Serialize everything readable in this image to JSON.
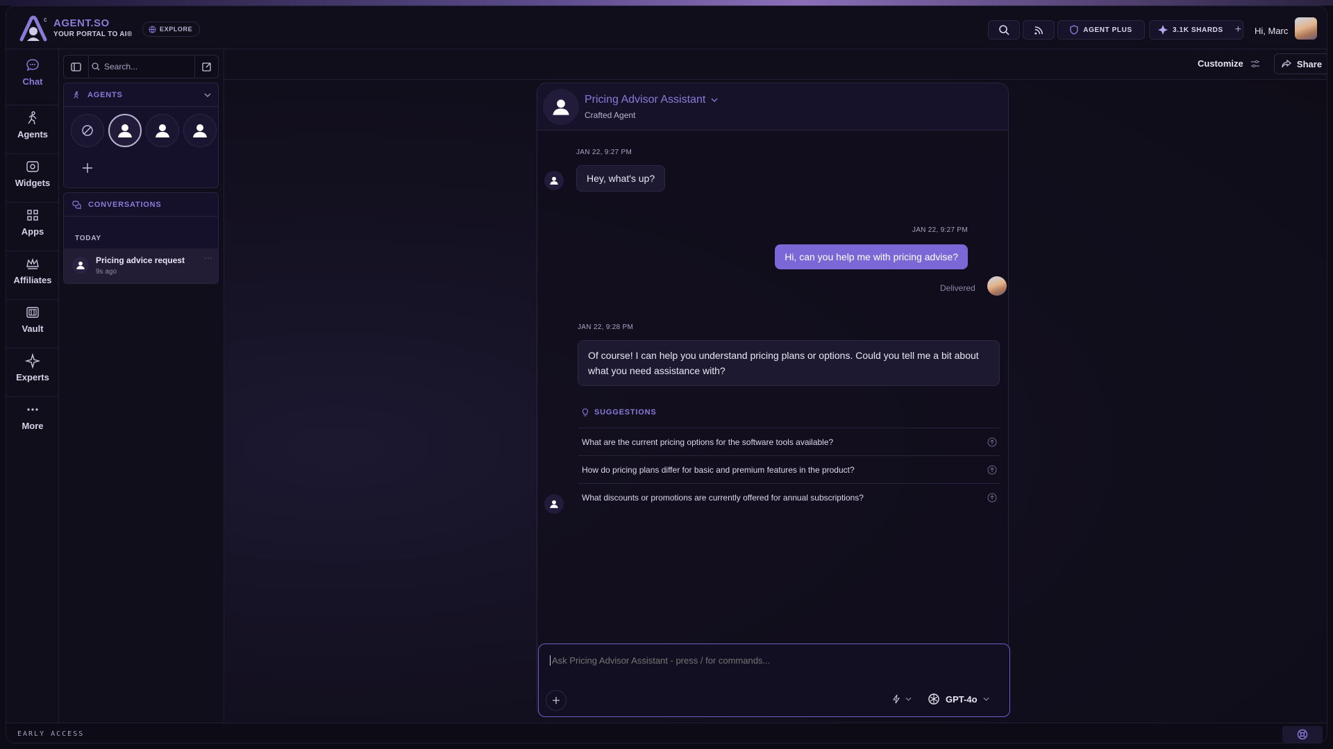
{
  "brand": {
    "name": "AGENT.SO",
    "tagline": "YOUR PORTAL TO AI®",
    "explore_label": "EXPLORE"
  },
  "header": {
    "agent_plus_label": "AGENT PLUS",
    "shards_label": "3.1K SHARDS",
    "greeting": "Hi, Marc"
  },
  "nav": {
    "items": [
      {
        "label": "Chat",
        "icon": "chat-bubble-icon"
      },
      {
        "label": "Agents",
        "icon": "running-figure-icon"
      },
      {
        "label": "Widgets",
        "icon": "widget-icon"
      },
      {
        "label": "Apps",
        "icon": "grid-icon"
      },
      {
        "label": "Affiliates",
        "icon": "crown-icon"
      },
      {
        "label": "Vault",
        "icon": "vault-icon"
      },
      {
        "label": "Experts",
        "icon": "sparkle-icon"
      },
      {
        "label": "More",
        "icon": "dots-icon"
      }
    ]
  },
  "sidebar": {
    "search_placeholder": "Search...",
    "agents_title": "AGENTS",
    "conversations_title": "CONVERSATIONS",
    "today_label": "TODAY",
    "conversation": {
      "title": "Pricing advice request",
      "time": "9s ago"
    }
  },
  "toolbar": {
    "customize_label": "Customize",
    "share_label": "Share"
  },
  "chat": {
    "agent_name": "Pricing Advisor Assistant",
    "agent_type": "Crafted Agent",
    "messages": [
      {
        "time": "JAN 22, 9:27 PM",
        "text": "Hey, what's up?"
      },
      {
        "time": "JAN 22, 9:27 PM",
        "text": "Hi, can you help me with pricing advise?",
        "status": "Delivered"
      },
      {
        "time": "JAN 22, 9:28 PM",
        "text": "Of course! I can help you understand pricing plans or options. Could you tell me a bit about what you need assistance with?"
      }
    ],
    "suggestions_title": "SUGGESTIONS",
    "suggestions": [
      "What are the current pricing options for the software tools available?",
      "How do pricing plans differ for basic and premium features in the product?",
      "What discounts or promotions are currently offered for annual subscriptions?"
    ]
  },
  "composer": {
    "placeholder": "Ask Pricing Advisor Assistant - press / for commands...",
    "model": "GPT-4o"
  },
  "footer": {
    "label": "EARLY ACCESS"
  },
  "colors": {
    "accent": "#8b7bd8",
    "user_bubble": "#7b68d6",
    "background": "#110e1c"
  }
}
